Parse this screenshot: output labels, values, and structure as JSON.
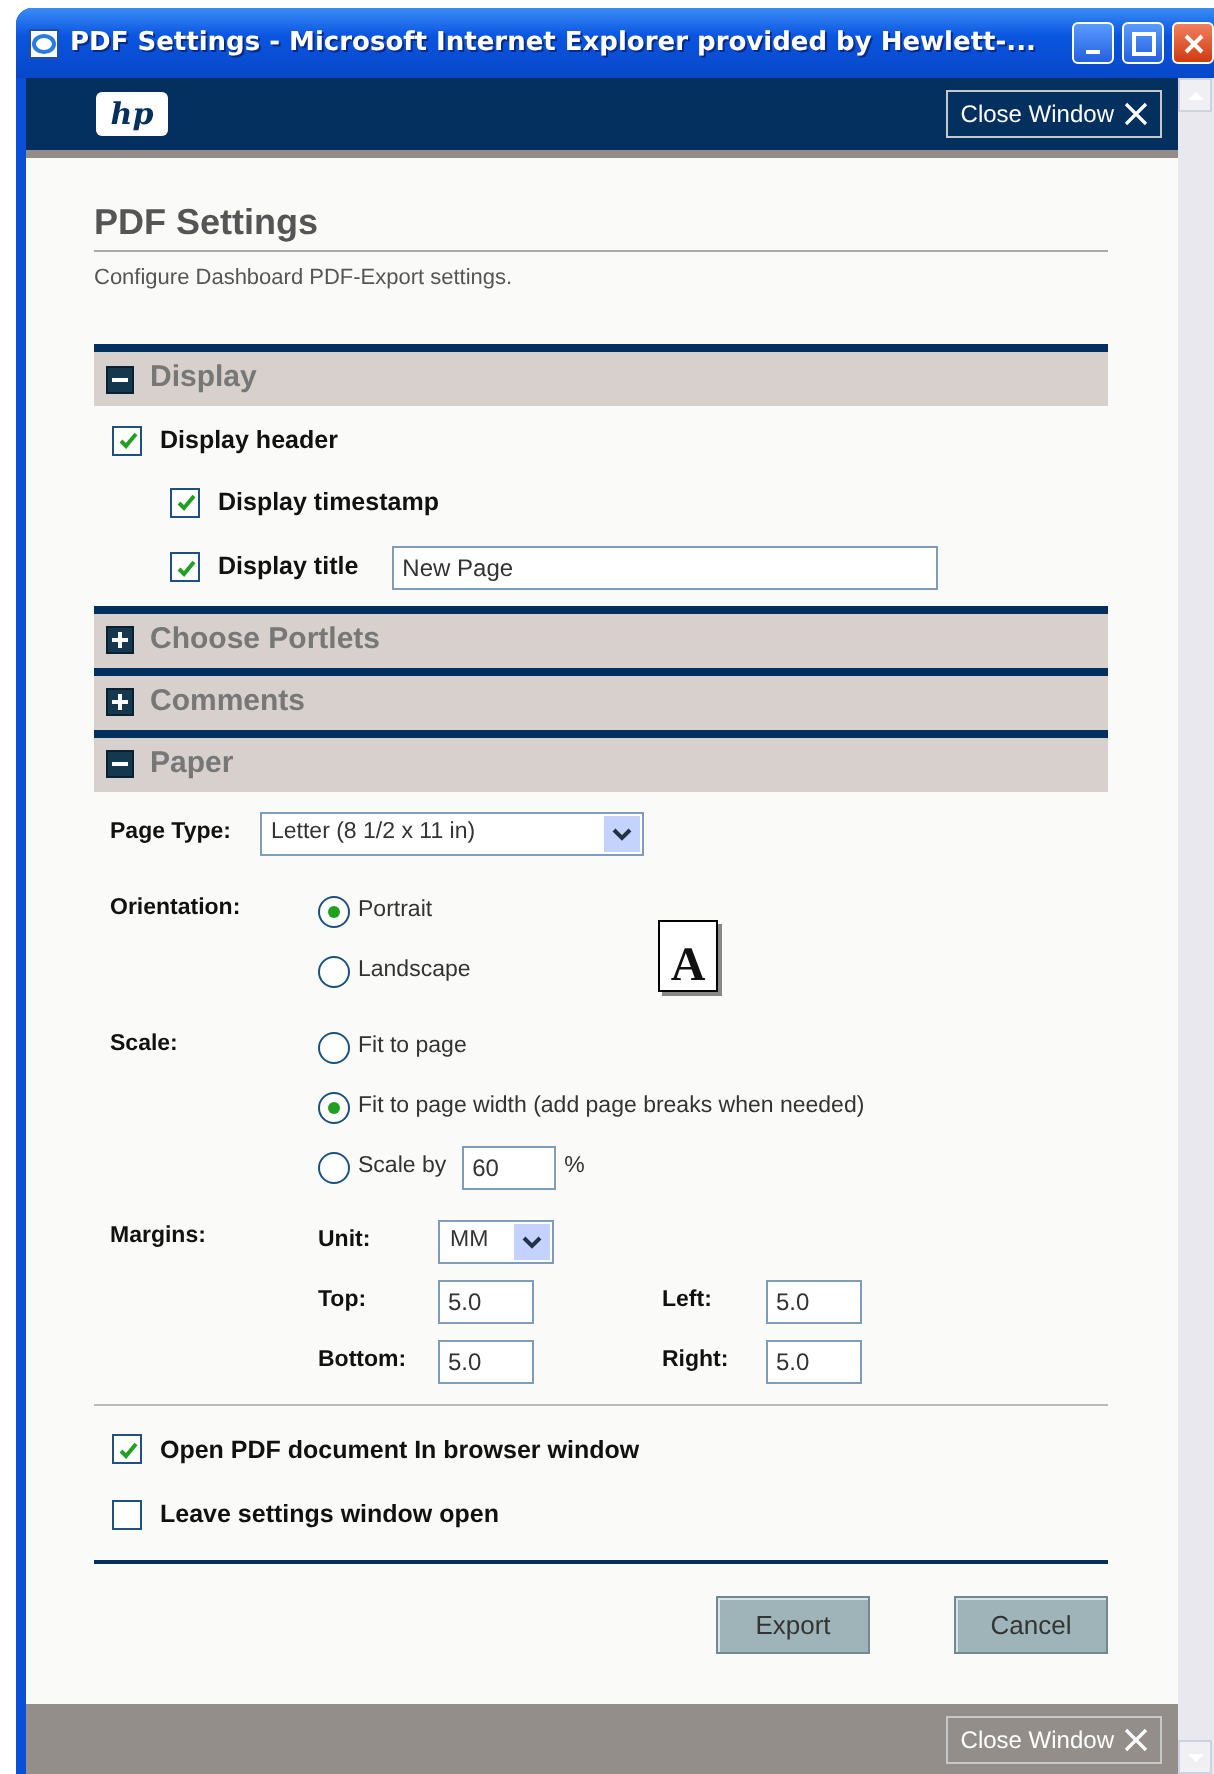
{
  "window": {
    "title": "PDF Settings - Microsoft Internet Explorer provided by Hewlett-..."
  },
  "header": {
    "logo": "hp",
    "close_label": "Close Window"
  },
  "page": {
    "title": "PDF Settings",
    "subtitle": "Configure Dashboard PDF-Export settings."
  },
  "sections": [
    {
      "kind": "display",
      "title": "Display",
      "expanded": true,
      "options": [
        {
          "label": "Display header",
          "checked": true,
          "indent": false
        },
        {
          "label": "Display timestamp",
          "checked": true,
          "indent": true
        },
        {
          "label": "Display title",
          "checked": true,
          "indent": true,
          "value": "New Page"
        }
      ]
    },
    {
      "title": "Choose Portlets",
      "expanded": false
    },
    {
      "title": "Comments",
      "expanded": false
    },
    {
      "kind": "paper",
      "title": "Paper",
      "expanded": true,
      "page_type": {
        "label": "Page Type:",
        "value": "Letter (8 1/2 x 11 in)"
      },
      "orientation": {
        "label": "Orientation:",
        "preview": "A",
        "options": [
          {
            "label": "Portrait",
            "selected": true
          },
          {
            "label": "Landscape",
            "selected": false
          }
        ]
      },
      "scale": {
        "label": "Scale:",
        "options": [
          {
            "label": "Fit to page",
            "selected": false
          },
          {
            "label": "Fit to page width (add page breaks when needed)",
            "selected": true
          },
          {
            "label": "Scale by",
            "selected": false,
            "value": "60",
            "unit": "%"
          }
        ]
      },
      "margins": {
        "label": "Margins:",
        "unit_label": "Unit:",
        "unit": "MM",
        "fields": [
          {
            "label": "Top:",
            "value": "5.0"
          },
          {
            "label": "Left:",
            "value": "5.0"
          },
          {
            "label": "Bottom:",
            "value": "5.0"
          },
          {
            "label": "Right:",
            "value": "5.0"
          }
        ]
      }
    }
  ],
  "options": [
    {
      "label": "Open PDF document In browser window",
      "checked": true
    },
    {
      "label": "Leave settings window open",
      "checked": false
    }
  ],
  "buttons": [
    "Export",
    "Cancel"
  ],
  "footer": {
    "close_label": "Close Window"
  }
}
